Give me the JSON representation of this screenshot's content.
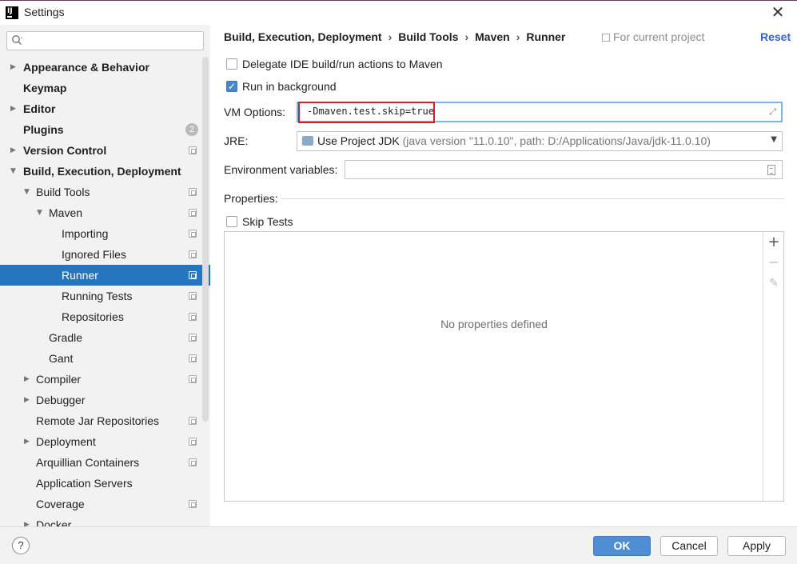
{
  "window": {
    "title": "Settings"
  },
  "search": {
    "placeholder": ""
  },
  "sidebar": {
    "items": [
      {
        "label": "Appearance & Behavior",
        "bold": true,
        "arrow": "▶"
      },
      {
        "label": "Keymap",
        "bold": true
      },
      {
        "label": "Editor",
        "bold": true,
        "arrow": "▶"
      },
      {
        "label": "Plugins",
        "bold": true,
        "badge": "2"
      },
      {
        "label": "Version Control",
        "bold": true,
        "arrow": "▶"
      },
      {
        "label": "Build, Execution, Deployment",
        "bold": true,
        "arrow": "▼"
      },
      {
        "label": "Build Tools",
        "arrow": "▼"
      },
      {
        "label": "Maven",
        "arrow": "▼"
      },
      {
        "label": "Importing"
      },
      {
        "label": "Ignored Files"
      },
      {
        "label": "Runner",
        "selected": true
      },
      {
        "label": "Running Tests"
      },
      {
        "label": "Repositories"
      },
      {
        "label": "Gradle"
      },
      {
        "label": "Gant"
      },
      {
        "label": "Compiler",
        "arrow": "▶"
      },
      {
        "label": "Debugger",
        "arrow": "▶"
      },
      {
        "label": "Remote Jar Repositories"
      },
      {
        "label": "Deployment",
        "arrow": "▶"
      },
      {
        "label": "Arquillian Containers"
      },
      {
        "label": "Application Servers"
      },
      {
        "label": "Coverage"
      },
      {
        "label": "Docker",
        "arrow": "▶"
      }
    ]
  },
  "header": {
    "breadcrumbs": [
      "Build, Execution, Deployment",
      "Build Tools",
      "Maven",
      "Runner"
    ],
    "separator": "›",
    "scope_label": "For current project",
    "reset_label": "Reset"
  },
  "runner": {
    "delegate_label": "Delegate IDE build/run actions to Maven",
    "delegate_checked": false,
    "background_label": "Run in background",
    "background_checked": true,
    "vm_options_label": "VM Options:",
    "vm_options_value": "-Dmaven.test.skip=true",
    "jre_label": "JRE:",
    "jre_value": "Use Project JDK",
    "jre_detail": "(java version \"11.0.10\", path: D:/Applications/Java/jdk-11.0.10)",
    "env_label": "Environment variables:",
    "env_value": "",
    "properties_label": "Properties:",
    "skip_tests_label": "Skip Tests",
    "skip_tests_checked": false,
    "empty_properties": "No properties defined",
    "add_symbol": "+",
    "remove_symbol": "−",
    "edit_symbol": "✎"
  },
  "footer": {
    "help_label": "?",
    "ok_label": "OK",
    "cancel_label": "Cancel",
    "apply_label": "Apply"
  },
  "colors": {
    "selection": "#2675bf",
    "highlight_box": "#d81e28",
    "primary_button": "#4e8ed3",
    "link": "#2f65ca"
  }
}
